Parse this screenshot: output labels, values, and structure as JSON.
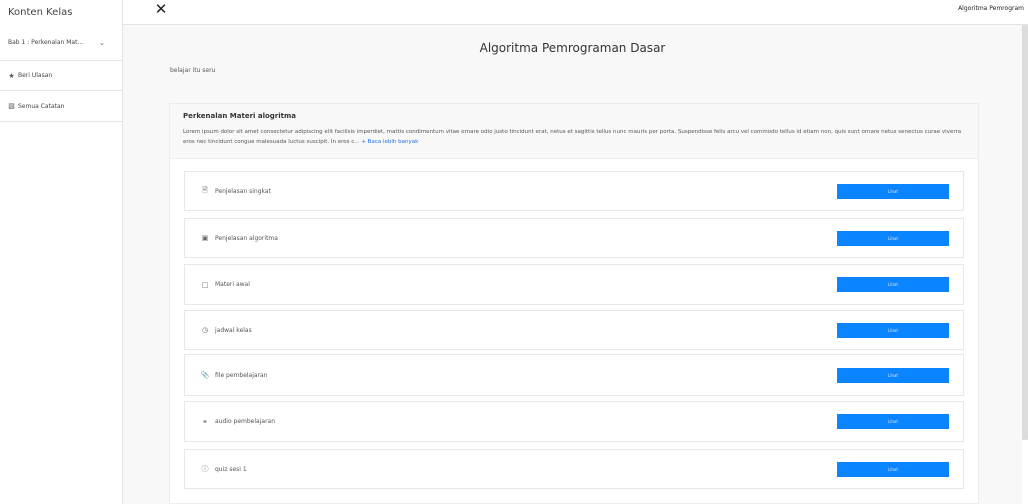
{
  "sidebar": {
    "title": "Konten Kelas",
    "chapter": "Bab 1 : Perkenalan Mat...",
    "review": "Beri Ulasan",
    "notes": "Semua Catatan"
  },
  "topbar": {
    "course_title": "Algoritma Pemrogram"
  },
  "main": {
    "title": "Algoritma Pemrograman Dasar",
    "subtitle": "belajar itu seru",
    "card": {
      "title": "Perkenalan Materi alogritma",
      "description": "Lorem ipsum dolor sit amet consectetur adipiscing elit facilisis imperdiet, mattis condimentum vitae ornare odio justo tincidunt erat, netus et sagittis tellus nunc mauris per porta. Suspendisse felis arcu vel commodo tellus id etiam non, quis sunt ornare netus senectus curae viverra eros nec tincidunt congue malesuada luctus suscipit. In eros c...",
      "read_more": "+ Baca lebih banyak"
    },
    "items": [
      {
        "label": "Penjelasan singkat",
        "icon": "document-icon",
        "button": "Lihat"
      },
      {
        "label": "Penjelasan algoritma",
        "icon": "video-icon",
        "button": "Lihat"
      },
      {
        "label": "Materi awal",
        "icon": "square-icon",
        "button": "Lihat"
      },
      {
        "label": "jadwal kelas",
        "icon": "clock-icon",
        "button": "Lihat"
      },
      {
        "label": "file pembelajaran",
        "icon": "paperclip-icon",
        "button": "Lihat"
      },
      {
        "label": "audio pembelajaran",
        "icon": "headphones-icon",
        "button": "Lihat"
      },
      {
        "label": "quiz sesi 1",
        "icon": "question-icon",
        "button": "Lihat"
      }
    ]
  },
  "colors": {
    "primary_button": "#0a84ff",
    "link": "#1a73e8"
  }
}
